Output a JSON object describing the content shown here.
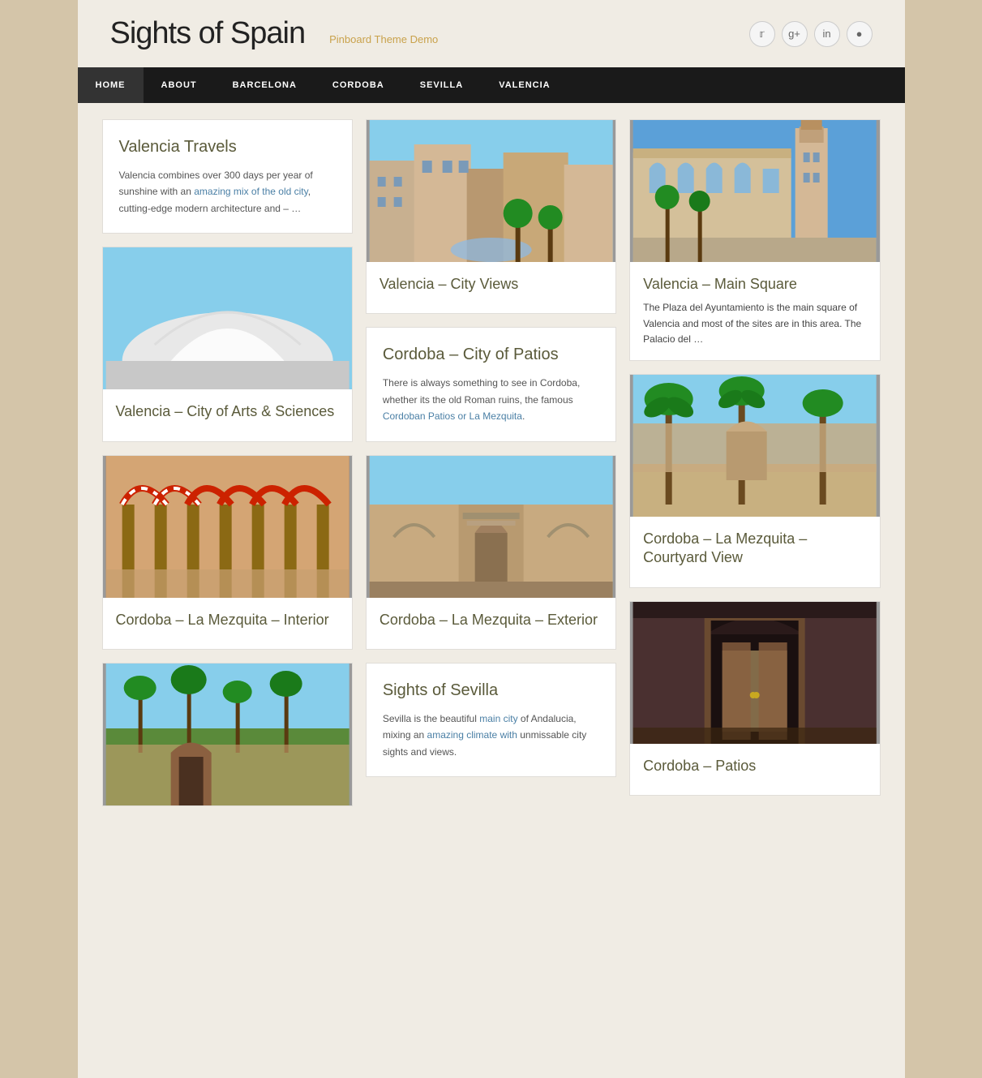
{
  "site": {
    "title": "Sights of Spain",
    "tagline": "Pinboard Theme Demo"
  },
  "header": {
    "icons": [
      {
        "name": "twitter-icon",
        "symbol": "🐦"
      },
      {
        "name": "google-icon",
        "symbol": "G"
      },
      {
        "name": "linkedin-icon",
        "symbol": "in"
      },
      {
        "name": "search-icon",
        "symbol": "🔍"
      }
    ]
  },
  "nav": {
    "items": [
      {
        "label": "HOME",
        "active": true
      },
      {
        "label": "ABOUT",
        "active": false
      },
      {
        "label": "BARCELONA",
        "active": false
      },
      {
        "label": "CORDOBA",
        "active": false
      },
      {
        "label": "SEVILLA",
        "active": false
      },
      {
        "label": "VALENCIA",
        "active": false
      }
    ]
  },
  "cards": {
    "col1": [
      {
        "id": "valencia-travels",
        "type": "text-only",
        "title": "Valencia Travels",
        "text": "Valencia combines over 300 days per year of sunshine with an amazing mix of the old city, cutting-edge modern architecture and – …"
      },
      {
        "id": "valencia-arts",
        "type": "image-title",
        "imgClass": "img-valencia-arts",
        "title": "Valencia – City of Arts & Sciences"
      },
      {
        "id": "cordoba-mezquita-interior",
        "type": "image-title",
        "imgClass": "img-mezquita-interior",
        "title": "Cordoba – La Mezquita – Interior"
      },
      {
        "id": "sevilla-bottom",
        "type": "image-only",
        "imgClass": "img-sevilla"
      }
    ],
    "col2": [
      {
        "id": "valencia-city-views",
        "type": "image-title",
        "imgClass": "img-valencia-city",
        "title": "Valencia – City Views"
      },
      {
        "id": "cordoba-patios",
        "type": "text-only",
        "title": "Cordoba – City of Patios",
        "text": "There is always something to see in Cordoba, whether its the old Roman ruins, the famous Cordoban Patios or La Mezquita."
      },
      {
        "id": "cordoba-mezquita-exterior",
        "type": "image-title",
        "imgClass": "img-mezquita-exterior",
        "title": "Cordoba – La Mezquita – Exterior"
      },
      {
        "id": "sights-of-sevilla",
        "type": "text-only",
        "title": "Sights of Sevilla",
        "text": "Sevilla is the beautiful main city of Andalucia, mixing an amazing climate with unmissable city sights and views."
      }
    ],
    "col3": [
      {
        "id": "valencia-main-square",
        "type": "image-text",
        "imgClass": "img-valencia-square",
        "title": "Valencia – Main Square",
        "text": "The Plaza del Ayuntamiento is the main square of Valencia and most of the sites are in this area. The Palacio del …"
      },
      {
        "id": "cordoba-courtyard",
        "type": "image-title",
        "imgClass": "img-cordoba-courtyard",
        "title": "Cordoba – La Mezquita – Courtyard View"
      },
      {
        "id": "cordoba-patios-img",
        "type": "image-title",
        "imgClass": "img-cordoba-patios",
        "title": "Cordoba – Patios"
      }
    ]
  }
}
